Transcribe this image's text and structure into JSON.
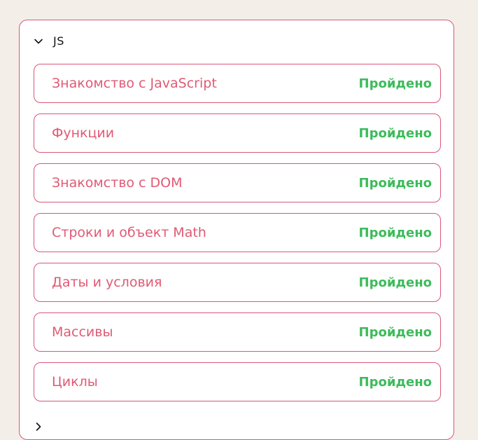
{
  "section": {
    "title": "JS",
    "icon": "chevron-down-icon"
  },
  "lessons": [
    {
      "title": "Знакомство с JavaScript",
      "status": "Пройдено"
    },
    {
      "title": "Функции",
      "status": "Пройдено"
    },
    {
      "title": "Знакомство с DOM",
      "status": "Пройдено"
    },
    {
      "title": "Строки и объект Math",
      "status": "Пройдено"
    },
    {
      "title": "Даты и условия",
      "status": "Пройдено"
    },
    {
      "title": "Массивы",
      "status": "Пройдено"
    },
    {
      "title": "Циклы",
      "status": "Пройдено"
    }
  ],
  "colors": {
    "accent": "#d9577a",
    "lesson_title": "#e05a74",
    "status_done": "#3dbb5b",
    "background": "#f3efe8"
  }
}
